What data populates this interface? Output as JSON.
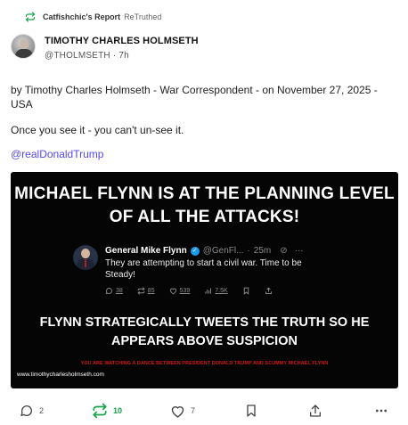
{
  "retruth": {
    "user": "Catfishchic's Report",
    "label": "ReTruthed",
    "icon": "retruth-icon"
  },
  "author": {
    "display_name": "TIMOTHY CHARLES HOLMSETH",
    "handle": "@THOLMSETH",
    "time": "7h",
    "separator": "·"
  },
  "post": {
    "line1": "by Timothy Charles Holmseth - War Correspondent - on November 27, 2025 - USA",
    "line2": "Once you see it - you can't un-see it.",
    "mention": "@realDonaldTrump"
  },
  "media": {
    "headline": "MICHAEL FLYNN IS AT THE PLANNING LEVEL OF ALL THE ATTACKS!",
    "tweet": {
      "name": "General Mike Flynn",
      "handle": "@GenFl...",
      "time": "25m",
      "separator": "·",
      "more": "···",
      "text": "They are attempting to start a civil war. Time to be Steady!",
      "replies": "38",
      "retweets": "85",
      "likes": "539",
      "views": "7.5K"
    },
    "subheadline": "FLYNN STRATEGICALLY TWEETS THE TRUTH SO HE APPEARS ABOVE SUSPICION",
    "red_text": "YOU ARE WATCHING A DANCE BETWEEN PRESIDENT DONALD TRUMP AND SCUMMY MICHAEL FLYNN",
    "url": "www.timothycharlesholmseth.com"
  },
  "actions": {
    "replies": "2",
    "retruths": "10",
    "likes": "7",
    "icons": [
      "reply-icon",
      "retruth-icon",
      "like-icon",
      "bookmark-icon",
      "share-icon",
      "more-icon"
    ]
  },
  "colors": {
    "accent_link": "#5448ee",
    "retruth_green": "#1aa34a",
    "red_text": "#d11b1b"
  }
}
